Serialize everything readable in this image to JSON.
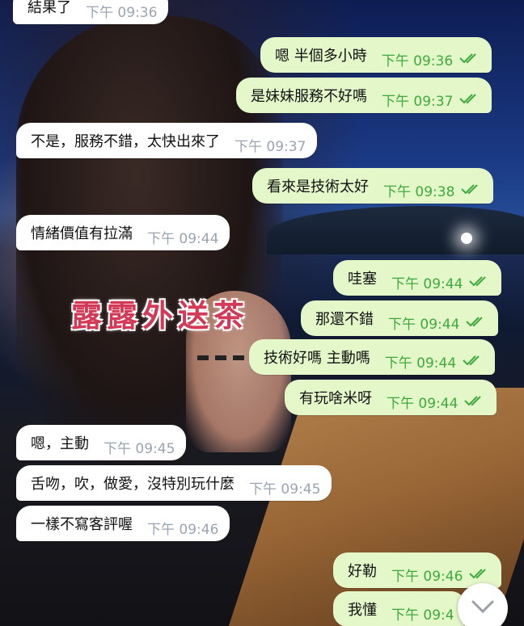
{
  "messages": [
    {
      "dir": "in",
      "text": "結果了",
      "time": "下午 09:36"
    },
    {
      "dir": "out",
      "text": "嗯  半個多小時",
      "time": "下午 09:36"
    },
    {
      "dir": "out",
      "text": "是妹妹服務不好嗎",
      "time": "下午 09:37"
    },
    {
      "dir": "in",
      "text": "不是，服務不錯，太快出來了",
      "time": "下午 09:37"
    },
    {
      "dir": "out",
      "text": "看來是技術太好",
      "time": "下午 09:38"
    },
    {
      "dir": "in",
      "text": "情緒價值有拉滿",
      "time": "下午 09:44"
    },
    {
      "dir": "out",
      "text": "哇塞",
      "time": "下午 09:44"
    },
    {
      "dir": "out",
      "text": "那還不錯",
      "time": "下午 09:44"
    },
    {
      "dir": "out",
      "text": "技術好嗎 主動嗎",
      "time": "下午 09:44"
    },
    {
      "dir": "out",
      "text": "有玩啥米呀",
      "time": "下午 09:44"
    },
    {
      "dir": "in",
      "text": "嗯，主動",
      "time": "下午 09:45"
    },
    {
      "dir": "in",
      "text": "舌吻，吹，做愛，沒特別玩什麼",
      "time": "下午 09:45"
    },
    {
      "dir": "in",
      "text": "一樣不寫客評喔",
      "time": "下午 09:46"
    },
    {
      "dir": "out",
      "text": "好勒",
      "time": "下午 09:46"
    },
    {
      "dir": "out",
      "text": "我懂",
      "time": "下午 09:4"
    }
  ],
  "watermark": "露露外送茶",
  "icons": {
    "read_receipt": "double-check-icon",
    "scroll_down": "chevron-down-icon"
  },
  "colors": {
    "incoming_bubble": "#ffffff",
    "outgoing_bubble": "#e3f7c9",
    "outgoing_time": "#3eaa3e",
    "incoming_time": "#9aa5b1",
    "watermark": "#d33a58"
  }
}
